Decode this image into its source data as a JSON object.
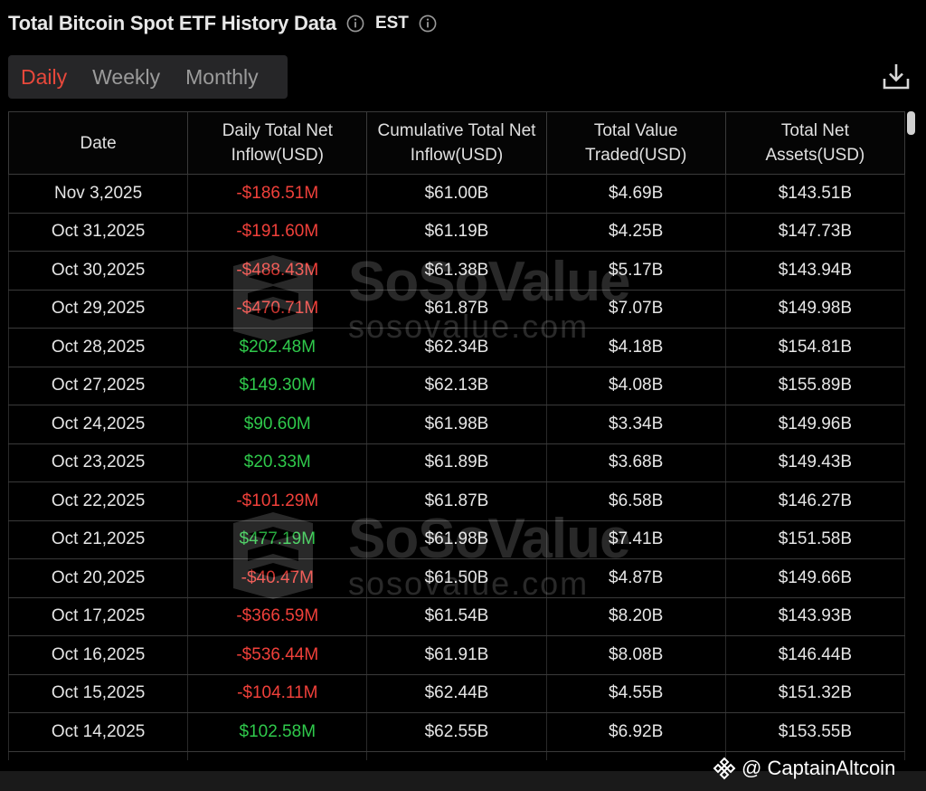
{
  "header": {
    "title": "Total Bitcoin Spot ETF History Data",
    "timezone": "EST"
  },
  "tabs": [
    {
      "label": "Daily",
      "active": true
    },
    {
      "label": "Weekly",
      "active": false
    },
    {
      "label": "Monthly",
      "active": false
    }
  ],
  "table": {
    "columns": [
      "Date",
      "Daily Total Net Inflow(USD)",
      "Cumulative Total Net Inflow(USD)",
      "Total Value Traded(USD)",
      "Total Net Assets(USD)"
    ],
    "rows": [
      {
        "date": "Nov 3,2025",
        "daily": "-$186.51M",
        "sign": "neg",
        "cumulative": "$61.00B",
        "traded": "$4.69B",
        "assets": "$143.51B"
      },
      {
        "date": "Oct 31,2025",
        "daily": "-$191.60M",
        "sign": "neg",
        "cumulative": "$61.19B",
        "traded": "$4.25B",
        "assets": "$147.73B"
      },
      {
        "date": "Oct 30,2025",
        "daily": "-$488.43M",
        "sign": "neg",
        "cumulative": "$61.38B",
        "traded": "$5.17B",
        "assets": "$143.94B"
      },
      {
        "date": "Oct 29,2025",
        "daily": "-$470.71M",
        "sign": "neg",
        "cumulative": "$61.87B",
        "traded": "$7.07B",
        "assets": "$149.98B"
      },
      {
        "date": "Oct 28,2025",
        "daily": "$202.48M",
        "sign": "pos",
        "cumulative": "$62.34B",
        "traded": "$4.18B",
        "assets": "$154.81B"
      },
      {
        "date": "Oct 27,2025",
        "daily": "$149.30M",
        "sign": "pos",
        "cumulative": "$62.13B",
        "traded": "$4.08B",
        "assets": "$155.89B"
      },
      {
        "date": "Oct 24,2025",
        "daily": "$90.60M",
        "sign": "pos",
        "cumulative": "$61.98B",
        "traded": "$3.34B",
        "assets": "$149.96B"
      },
      {
        "date": "Oct 23,2025",
        "daily": "$20.33M",
        "sign": "pos",
        "cumulative": "$61.89B",
        "traded": "$3.68B",
        "assets": "$149.43B"
      },
      {
        "date": "Oct 22,2025",
        "daily": "-$101.29M",
        "sign": "neg",
        "cumulative": "$61.87B",
        "traded": "$6.58B",
        "assets": "$146.27B"
      },
      {
        "date": "Oct 21,2025",
        "daily": "$477.19M",
        "sign": "pos",
        "cumulative": "$61.98B",
        "traded": "$7.41B",
        "assets": "$151.58B"
      },
      {
        "date": "Oct 20,2025",
        "daily": "-$40.47M",
        "sign": "neg",
        "cumulative": "$61.50B",
        "traded": "$4.87B",
        "assets": "$149.66B"
      },
      {
        "date": "Oct 17,2025",
        "daily": "-$366.59M",
        "sign": "neg",
        "cumulative": "$61.54B",
        "traded": "$8.20B",
        "assets": "$143.93B"
      },
      {
        "date": "Oct 16,2025",
        "daily": "-$536.44M",
        "sign": "neg",
        "cumulative": "$61.91B",
        "traded": "$8.08B",
        "assets": "$146.44B"
      },
      {
        "date": "Oct 15,2025",
        "daily": "-$104.11M",
        "sign": "neg",
        "cumulative": "$62.44B",
        "traded": "$4.55B",
        "assets": "$151.32B"
      },
      {
        "date": "Oct 14,2025",
        "daily": "$102.58M",
        "sign": "pos",
        "cumulative": "$62.55B",
        "traded": "$6.92B",
        "assets": "$153.55B"
      }
    ]
  },
  "watermark": {
    "name": "SoSoValue",
    "url": "sosovalue.com"
  },
  "credit": {
    "text": "@ CaptainAltcoin"
  },
  "colors": {
    "negative": "#f0403a",
    "positive": "#2fc94b",
    "active_tab": "#e8483b"
  },
  "icons": {
    "info": "info-icon",
    "download": "download-icon",
    "credit_logo": "binance-logo-icon"
  }
}
